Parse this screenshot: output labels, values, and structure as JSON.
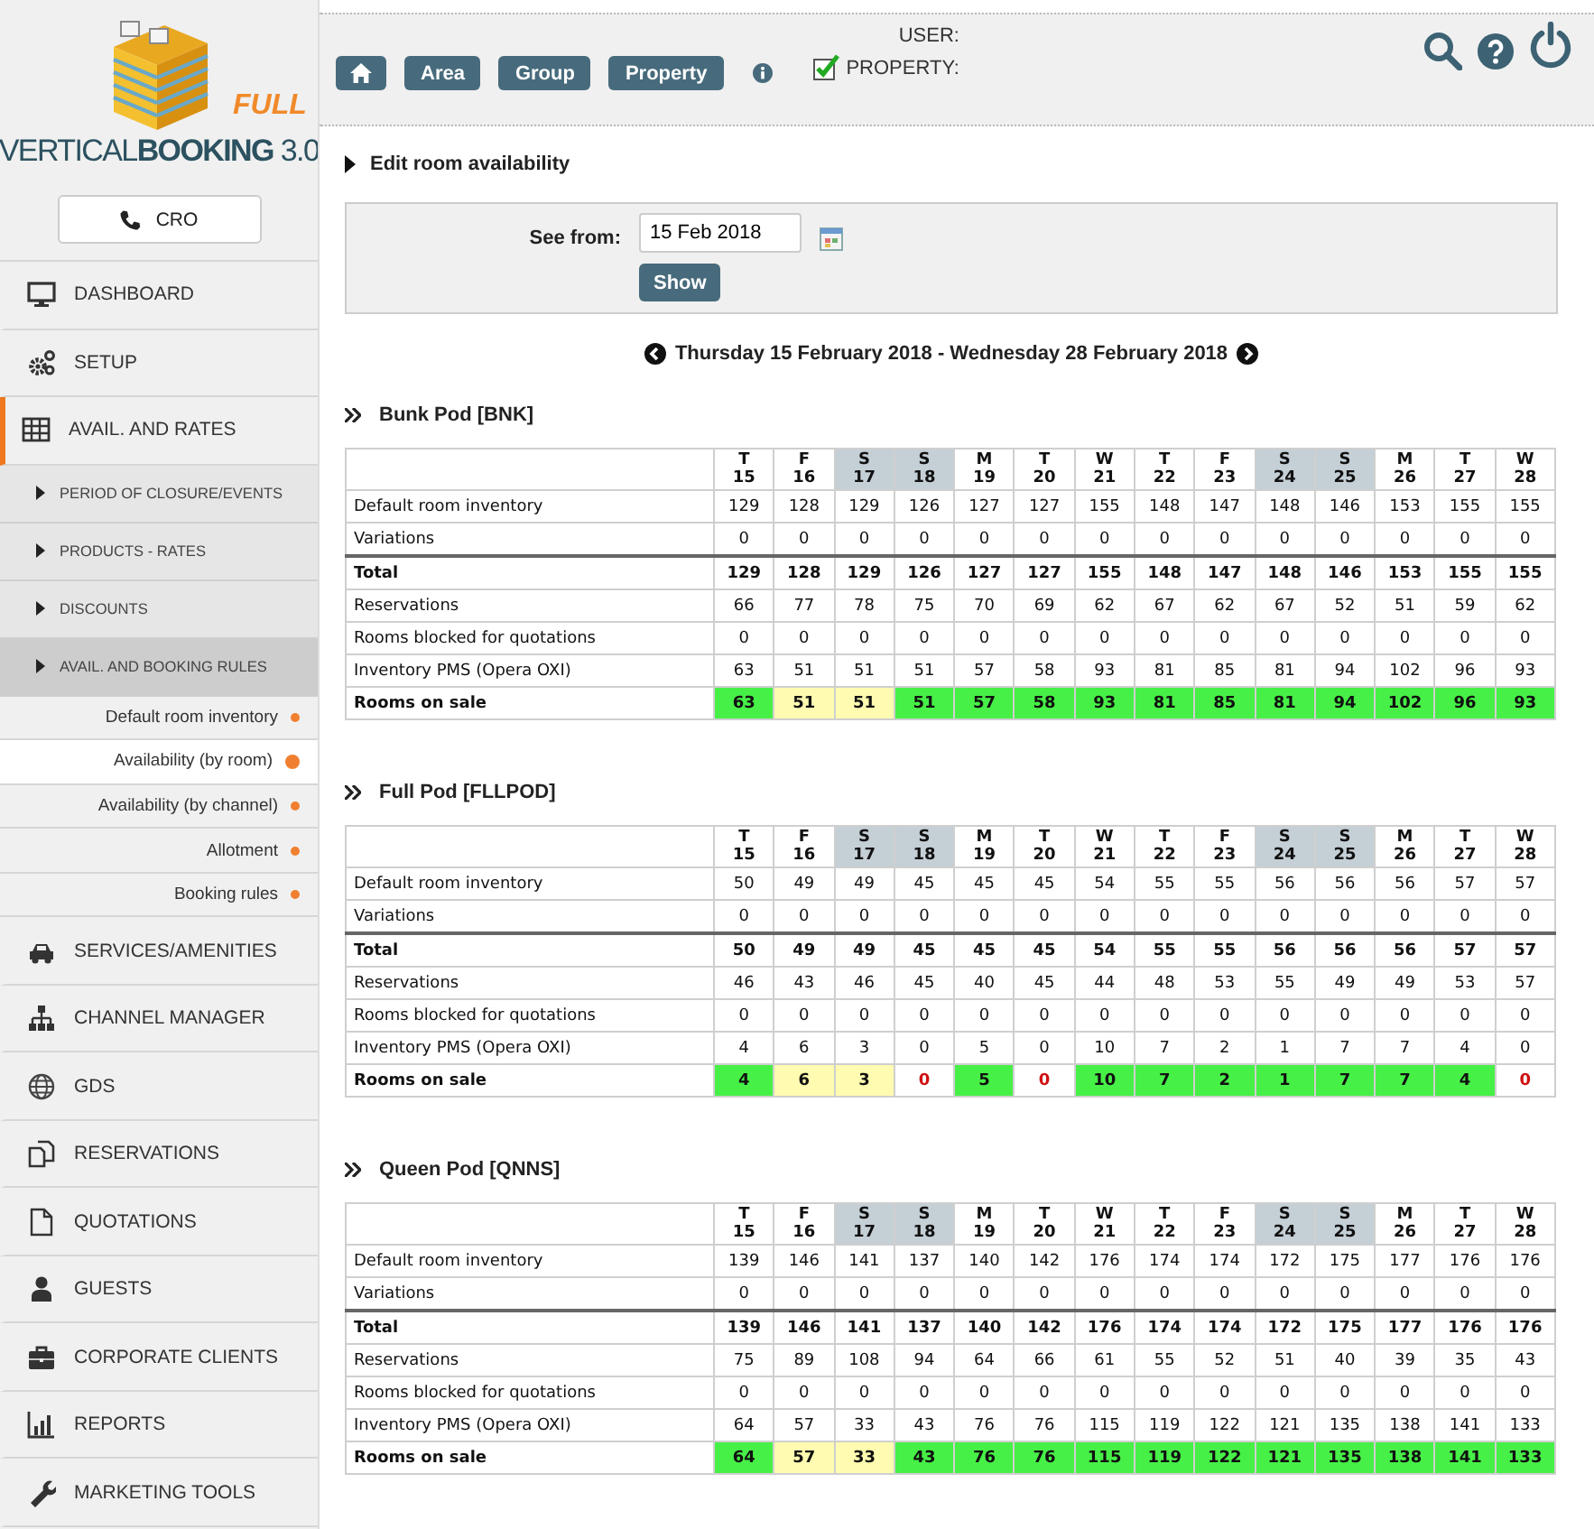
{
  "logo": {
    "edition": "FULL",
    "brand": "VERTICAL**BOOKING** 3.0"
  },
  "cro_button": "CRO",
  "sidebar": {
    "items": [
      {
        "label": "DASHBOARD",
        "selected": false
      },
      {
        "label": "SETUP",
        "selected": false
      },
      {
        "label": "AVAIL. AND RATES",
        "selected": true,
        "children": [
          {
            "label": "PERIOD OF CLOSURE/EVENTS",
            "selected": false
          },
          {
            "label": "PRODUCTS - RATES",
            "selected": false
          },
          {
            "label": "DISCOUNTS",
            "selected": false
          },
          {
            "label": "AVAIL. AND BOOKING RULES",
            "selected": true,
            "children": [
              {
                "label": "Default room inventory",
                "selected": false
              },
              {
                "label": "Availability (by room)",
                "selected": true
              },
              {
                "label": "Availability (by channel)",
                "selected": false
              },
              {
                "label": "Allotment",
                "selected": false
              },
              {
                "label": "Booking rules",
                "selected": false
              }
            ]
          }
        ]
      },
      {
        "label": "SERVICES/AMENITIES",
        "selected": false
      },
      {
        "label": "CHANNEL MANAGER",
        "selected": false
      },
      {
        "label": "GDS",
        "selected": false
      },
      {
        "label": "RESERVATIONS",
        "selected": false
      },
      {
        "label": "QUOTATIONS",
        "selected": false
      },
      {
        "label": "GUESTS",
        "selected": false
      },
      {
        "label": "CORPORATE CLIENTS",
        "selected": false
      },
      {
        "label": "REPORTS",
        "selected": false
      },
      {
        "label": "MARKETING TOOLS",
        "selected": false
      }
    ]
  },
  "topbar": {
    "scope_buttons": [
      "Area",
      "Group",
      "Property"
    ],
    "user_label": "USER:",
    "property_label": "PROPERTY:",
    "property_checked": true
  },
  "section_title": "Edit room availability",
  "filter": {
    "label": "See from:",
    "value": "15 Feb 2018",
    "button": "Show"
  },
  "period": "Thursday 15 February 2018 - Wednesday 28 February 2018",
  "pods": [
    {
      "title": "Bunk Pod [BNK]",
      "days": [
        {
          "weekday": "T",
          "day": "15",
          "weekend": false
        },
        {
          "weekday": "F",
          "day": "16",
          "weekend": false
        },
        {
          "weekday": "S",
          "day": "17",
          "weekend": true
        },
        {
          "weekday": "S",
          "day": "18",
          "weekend": true
        },
        {
          "weekday": "M",
          "day": "19",
          "weekend": false
        },
        {
          "weekday": "T",
          "day": "20",
          "weekend": false
        },
        {
          "weekday": "W",
          "day": "21",
          "weekend": false
        },
        {
          "weekday": "T",
          "day": "22",
          "weekend": false
        },
        {
          "weekday": "F",
          "day": "23",
          "weekend": false
        },
        {
          "weekday": "S",
          "day": "24",
          "weekend": true
        },
        {
          "weekday": "S",
          "day": "25",
          "weekend": true
        },
        {
          "weekday": "M",
          "day": "26",
          "weekend": false
        },
        {
          "weekday": "T",
          "day": "27",
          "weekend": false
        },
        {
          "weekday": "W",
          "day": "28",
          "weekend": false
        }
      ],
      "rows": [
        {
          "label": "Default room inventory",
          "kind": "plain",
          "values": [
            "129",
            "128",
            "129",
            "126",
            "127",
            "127",
            "155",
            "148",
            "147",
            "148",
            "146",
            "153",
            "155",
            "155"
          ]
        },
        {
          "label": "Variations",
          "kind": "plain",
          "values": [
            "0",
            "0",
            "0",
            "0",
            "0",
            "0",
            "0",
            "0",
            "0",
            "0",
            "0",
            "0",
            "0",
            "0"
          ]
        },
        {
          "label": "Total",
          "kind": "total",
          "values": [
            "129",
            "128",
            "129",
            "126",
            "127",
            "127",
            "155",
            "148",
            "147",
            "148",
            "146",
            "153",
            "155",
            "155"
          ]
        },
        {
          "label": "Reservations",
          "kind": "plain",
          "values": [
            "66",
            "77",
            "78",
            "75",
            "70",
            "69",
            "62",
            "67",
            "62",
            "67",
            "52",
            "51",
            "59",
            "62"
          ]
        },
        {
          "label": "Rooms blocked for quotations",
          "kind": "plain",
          "values": [
            "0",
            "0",
            "0",
            "0",
            "0",
            "0",
            "0",
            "0",
            "0",
            "0",
            "0",
            "0",
            "0",
            "0"
          ]
        },
        {
          "label": "Inventory PMS (Opera OXI)",
          "kind": "plain",
          "values": [
            "63",
            "51",
            "51",
            "51",
            "57",
            "58",
            "93",
            "81",
            "85",
            "81",
            "94",
            "102",
            "96",
            "93"
          ]
        },
        {
          "label": "Rooms on sale",
          "kind": "sale",
          "cells": [
            {
              "value": "63",
              "color": "#47f047",
              "sold_out": false
            },
            {
              "value": "51",
              "color": "#fffbb0",
              "sold_out": false
            },
            {
              "value": "51",
              "color": "#fffbb0",
              "sold_out": false
            },
            {
              "value": "51",
              "color": "#47f047",
              "sold_out": false
            },
            {
              "value": "57",
              "color": "#47f047",
              "sold_out": false
            },
            {
              "value": "58",
              "color": "#47f047",
              "sold_out": false
            },
            {
              "value": "93",
              "color": "#47f047",
              "sold_out": false
            },
            {
              "value": "81",
              "color": "#47f047",
              "sold_out": false
            },
            {
              "value": "85",
              "color": "#47f047",
              "sold_out": false
            },
            {
              "value": "81",
              "color": "#47f047",
              "sold_out": false
            },
            {
              "value": "94",
              "color": "#47f047",
              "sold_out": false
            },
            {
              "value": "102",
              "color": "#47f047",
              "sold_out": false
            },
            {
              "value": "96",
              "color": "#47f047",
              "sold_out": false
            },
            {
              "value": "93",
              "color": "#47f047",
              "sold_out": false
            }
          ]
        }
      ]
    },
    {
      "title": "Full Pod [FLLPOD]",
      "days": [
        {
          "weekday": "T",
          "day": "15",
          "weekend": false
        },
        {
          "weekday": "F",
          "day": "16",
          "weekend": false
        },
        {
          "weekday": "S",
          "day": "17",
          "weekend": true
        },
        {
          "weekday": "S",
          "day": "18",
          "weekend": true
        },
        {
          "weekday": "M",
          "day": "19",
          "weekend": false
        },
        {
          "weekday": "T",
          "day": "20",
          "weekend": false
        },
        {
          "weekday": "W",
          "day": "21",
          "weekend": false
        },
        {
          "weekday": "T",
          "day": "22",
          "weekend": false
        },
        {
          "weekday": "F",
          "day": "23",
          "weekend": false
        },
        {
          "weekday": "S",
          "day": "24",
          "weekend": true
        },
        {
          "weekday": "S",
          "day": "25",
          "weekend": true
        },
        {
          "weekday": "M",
          "day": "26",
          "weekend": false
        },
        {
          "weekday": "T",
          "day": "27",
          "weekend": false
        },
        {
          "weekday": "W",
          "day": "28",
          "weekend": false
        }
      ],
      "rows": [
        {
          "label": "Default room inventory",
          "kind": "plain",
          "values": [
            "50",
            "49",
            "49",
            "45",
            "45",
            "45",
            "54",
            "55",
            "55",
            "56",
            "56",
            "56",
            "57",
            "57"
          ]
        },
        {
          "label": "Variations",
          "kind": "plain",
          "values": [
            "0",
            "0",
            "0",
            "0",
            "0",
            "0",
            "0",
            "0",
            "0",
            "0",
            "0",
            "0",
            "0",
            "0"
          ]
        },
        {
          "label": "Total",
          "kind": "total",
          "values": [
            "50",
            "49",
            "49",
            "45",
            "45",
            "45",
            "54",
            "55",
            "55",
            "56",
            "56",
            "56",
            "57",
            "57"
          ]
        },
        {
          "label": "Reservations",
          "kind": "plain",
          "values": [
            "46",
            "43",
            "46",
            "45",
            "40",
            "45",
            "44",
            "48",
            "53",
            "55",
            "49",
            "49",
            "53",
            "57"
          ]
        },
        {
          "label": "Rooms blocked for quotations",
          "kind": "plain",
          "values": [
            "0",
            "0",
            "0",
            "0",
            "0",
            "0",
            "0",
            "0",
            "0",
            "0",
            "0",
            "0",
            "0",
            "0"
          ]
        },
        {
          "label": "Inventory PMS (Opera OXI)",
          "kind": "plain",
          "values": [
            "4",
            "6",
            "3",
            "0",
            "5",
            "0",
            "10",
            "7",
            "2",
            "1",
            "7",
            "7",
            "4",
            "0"
          ]
        },
        {
          "label": "Rooms on sale",
          "kind": "sale",
          "cells": [
            {
              "value": "4",
              "color": "#47f047",
              "sold_out": false
            },
            {
              "value": "6",
              "color": "#fffbb0",
              "sold_out": false
            },
            {
              "value": "3",
              "color": "#fffbb0",
              "sold_out": false
            },
            {
              "value": "0",
              "color": "#ffffff",
              "sold_out": true
            },
            {
              "value": "5",
              "color": "#47f047",
              "sold_out": false
            },
            {
              "value": "0",
              "color": "#ffffff",
              "sold_out": true
            },
            {
              "value": "10",
              "color": "#47f047",
              "sold_out": false
            },
            {
              "value": "7",
              "color": "#47f047",
              "sold_out": false
            },
            {
              "value": "2",
              "color": "#47f047",
              "sold_out": false
            },
            {
              "value": "1",
              "color": "#47f047",
              "sold_out": false
            },
            {
              "value": "7",
              "color": "#47f047",
              "sold_out": false
            },
            {
              "value": "7",
              "color": "#47f047",
              "sold_out": false
            },
            {
              "value": "4",
              "color": "#47f047",
              "sold_out": false
            },
            {
              "value": "0",
              "color": "#ffffff",
              "sold_out": true
            }
          ]
        }
      ]
    },
    {
      "title": "Queen Pod [QNNS]",
      "days": [
        {
          "weekday": "T",
          "day": "15",
          "weekend": false
        },
        {
          "weekday": "F",
          "day": "16",
          "weekend": false
        },
        {
          "weekday": "S",
          "day": "17",
          "weekend": true
        },
        {
          "weekday": "S",
          "day": "18",
          "weekend": true
        },
        {
          "weekday": "M",
          "day": "19",
          "weekend": false
        },
        {
          "weekday": "T",
          "day": "20",
          "weekend": false
        },
        {
          "weekday": "W",
          "day": "21",
          "weekend": false
        },
        {
          "weekday": "T",
          "day": "22",
          "weekend": false
        },
        {
          "weekday": "F",
          "day": "23",
          "weekend": false
        },
        {
          "weekday": "S",
          "day": "24",
          "weekend": true
        },
        {
          "weekday": "S",
          "day": "25",
          "weekend": true
        },
        {
          "weekday": "M",
          "day": "26",
          "weekend": false
        },
        {
          "weekday": "T",
          "day": "27",
          "weekend": false
        },
        {
          "weekday": "W",
          "day": "28",
          "weekend": false
        }
      ],
      "rows": [
        {
          "label": "Default room inventory",
          "kind": "plain",
          "values": [
            "139",
            "146",
            "141",
            "137",
            "140",
            "142",
            "176",
            "174",
            "174",
            "172",
            "175",
            "177",
            "176",
            "176"
          ]
        },
        {
          "label": "Variations",
          "kind": "plain",
          "values": [
            "0",
            "0",
            "0",
            "0",
            "0",
            "0",
            "0",
            "0",
            "0",
            "0",
            "0",
            "0",
            "0",
            "0"
          ]
        },
        {
          "label": "Total",
          "kind": "total",
          "values": [
            "139",
            "146",
            "141",
            "137",
            "140",
            "142",
            "176",
            "174",
            "174",
            "172",
            "175",
            "177",
            "176",
            "176"
          ]
        },
        {
          "label": "Reservations",
          "kind": "plain",
          "values": [
            "75",
            "89",
            "108",
            "94",
            "64",
            "66",
            "61",
            "55",
            "52",
            "51",
            "40",
            "39",
            "35",
            "43"
          ]
        },
        {
          "label": "Rooms blocked for quotations",
          "kind": "plain",
          "values": [
            "0",
            "0",
            "0",
            "0",
            "0",
            "0",
            "0",
            "0",
            "0",
            "0",
            "0",
            "0",
            "0",
            "0"
          ]
        },
        {
          "label": "Inventory PMS (Opera OXI)",
          "kind": "plain",
          "values": [
            "64",
            "57",
            "33",
            "43",
            "76",
            "76",
            "115",
            "119",
            "122",
            "121",
            "135",
            "138",
            "141",
            "133"
          ]
        },
        {
          "label": "Rooms on sale",
          "kind": "sale",
          "cells": [
            {
              "value": "64",
              "color": "#47f047",
              "sold_out": false
            },
            {
              "value": "57",
              "color": "#fffbb0",
              "sold_out": false
            },
            {
              "value": "33",
              "color": "#fffbb0",
              "sold_out": false
            },
            {
              "value": "43",
              "color": "#47f047",
              "sold_out": false
            },
            {
              "value": "76",
              "color": "#47f047",
              "sold_out": false
            },
            {
              "value": "76",
              "color": "#47f047",
              "sold_out": false
            },
            {
              "value": "115",
              "color": "#47f047",
              "sold_out": false
            },
            {
              "value": "119",
              "color": "#47f047",
              "sold_out": false
            },
            {
              "value": "122",
              "color": "#47f047",
              "sold_out": false
            },
            {
              "value": "121",
              "color": "#47f047",
              "sold_out": false
            },
            {
              "value": "135",
              "color": "#47f047",
              "sold_out": false
            },
            {
              "value": "138",
              "color": "#47f047",
              "sold_out": false
            },
            {
              "value": "141",
              "color": "#47f047",
              "sold_out": false
            },
            {
              "value": "133",
              "color": "#47f047",
              "sold_out": false
            }
          ]
        }
      ]
    }
  ]
}
